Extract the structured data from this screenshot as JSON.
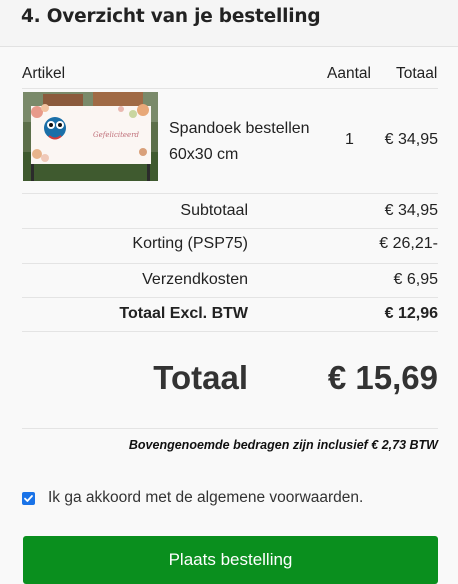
{
  "section": {
    "title": "4. Overzicht van je bestelling"
  },
  "table": {
    "headers": {
      "item": "Artikel",
      "quantity": "Aantal",
      "total": "Totaal"
    },
    "items": [
      {
        "name_line1": "Spandoek bestellen",
        "name_line2": "60x30 cm",
        "quantity": "1",
        "total": "€ 34,95",
        "banner_text": "Gefeliciteerd"
      }
    ]
  },
  "summary": {
    "subtotal_label": "Subtotaal",
    "subtotal_value": "€ 34,95",
    "discount_label": "Korting (PSP75)",
    "discount_value": "€ 26,21-",
    "shipping_label": "Verzendkosten",
    "shipping_value": "€ 6,95",
    "total_excl_label": "Totaal Excl. BTW",
    "total_excl_value": "€ 12,96"
  },
  "grand_total": {
    "label": "Totaal",
    "value": "€ 15,69"
  },
  "vat_note": "Bovengenoemde bedragen zijn inclusief € 2,73 BTW",
  "terms": {
    "label": "Ik ga akkoord met de algemene voorwaarden.",
    "checked": true
  },
  "order_button": {
    "label": "Plaats bestelling"
  },
  "colors": {
    "button": "#0a8f1e",
    "checkbox": "#1a73e8"
  }
}
